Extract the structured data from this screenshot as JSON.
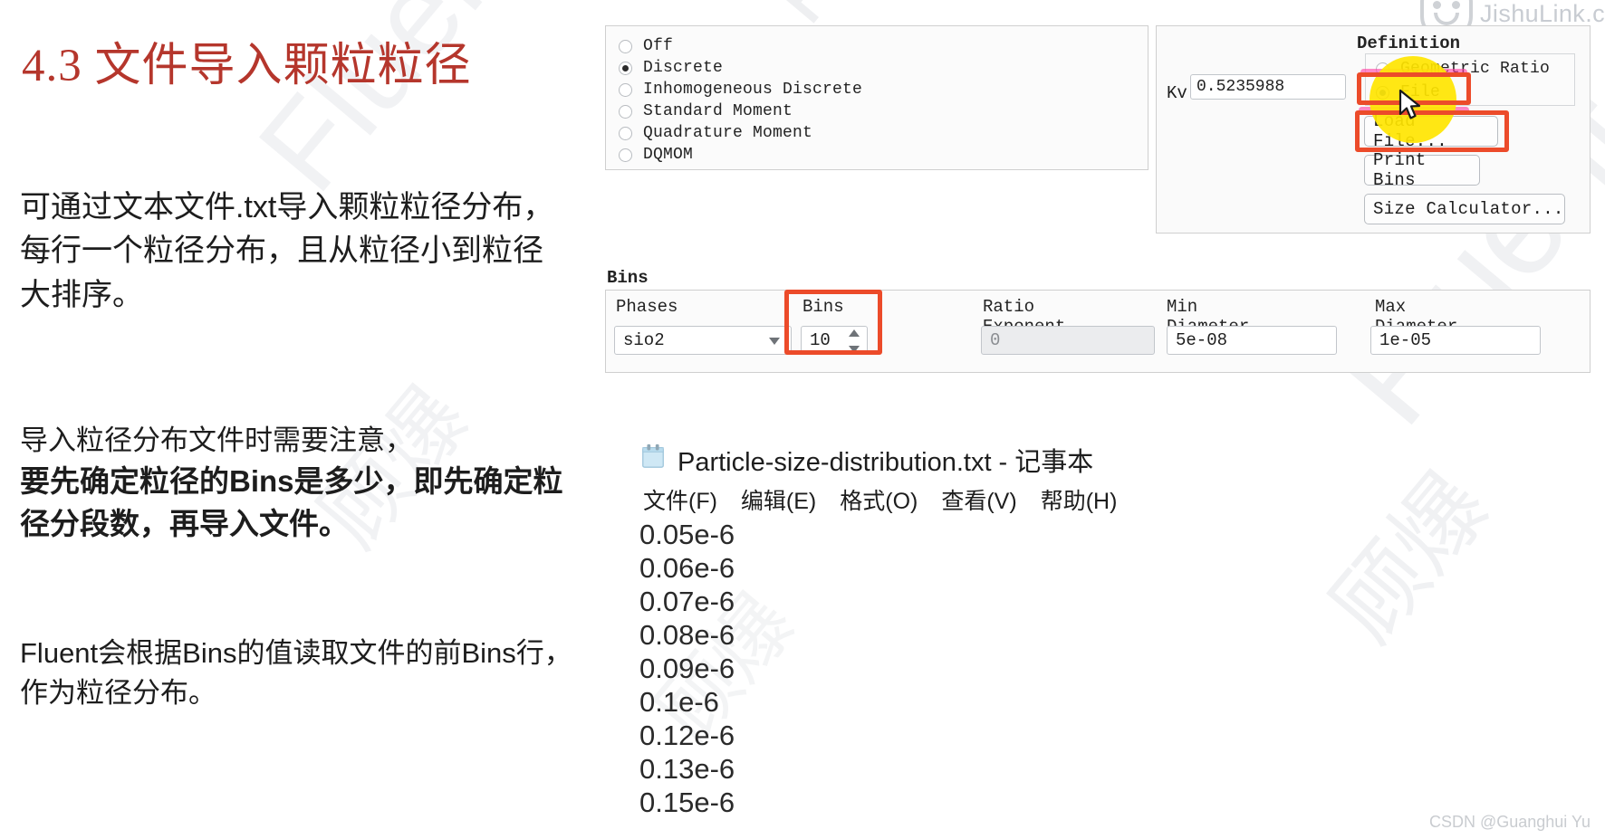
{
  "slide": {
    "title": "4.3 文件导入颗粒粒径",
    "title_color": "#b5362c",
    "paragraph_1": "可通过文本文件.txt导入颗粒粒径分布，每行一个粒径分布，且从粒径小到粒径大排序。",
    "paragraph_2_normal": "导入粒径分布文件时需要注意，",
    "paragraph_2_bold": "要先确定粒径的Bins是多少，即先确定粒径分段数，再导入文件。",
    "paragraph_3": "Fluent会根据Bins的值读取文件的前Bins行，作为粒径分布。"
  },
  "watermarks": {
    "brand_text": "Fluent",
    "cn_text": "顾爆",
    "jishulink": "JishuLink.c",
    "credit": "CSDN @Guanghui Yu"
  },
  "fluent_dialog": {
    "method_group": {
      "options": [
        {
          "label": "Off",
          "selected": false
        },
        {
          "label": "Discrete",
          "selected": true
        },
        {
          "label": "Inhomogeneous Discrete",
          "selected": false
        },
        {
          "label": "Standard Moment",
          "selected": false
        },
        {
          "label": "Quadrature Moment",
          "selected": false
        },
        {
          "label": "DQMOM",
          "selected": false
        }
      ]
    },
    "kv": {
      "label": "Kv",
      "value": "0.5235988"
    },
    "definition": {
      "title": "Definition",
      "options": [
        {
          "label": "Geometric Ratio",
          "selected": false
        },
        {
          "label": "File",
          "selected": true
        }
      ]
    },
    "buttons": {
      "load_file": "Load File...",
      "print_bins": "Print Bins",
      "size_calculator": "Size Calculator..."
    },
    "bins_section": {
      "caption": "Bins",
      "columns": [
        "Phases",
        "Bins",
        "Ratio Exponent",
        "Min Diameter (m)",
        "Max Diameter (m)"
      ],
      "values": {
        "phases": "sio2",
        "bins": "10",
        "ratio_exponent": "0",
        "min_diameter": "5e-08",
        "max_diameter": "1e-05"
      }
    }
  },
  "annotations": {
    "box_color": "#ec4b2a",
    "highlight_color": "#ffe500",
    "trail_color": "#ff3fa4"
  },
  "notepad": {
    "title": "Particle-size-distribution.txt - 记事本",
    "menu": [
      "文件(F)",
      "编辑(E)",
      "格式(O)",
      "查看(V)",
      "帮助(H)"
    ],
    "lines": [
      "0.05e-6",
      "0.06e-6",
      "0.07e-6",
      "0.08e-6",
      "0.09e-6",
      "0.1e-6",
      "0.12e-6",
      "0.13e-6",
      "0.15e-6"
    ]
  }
}
